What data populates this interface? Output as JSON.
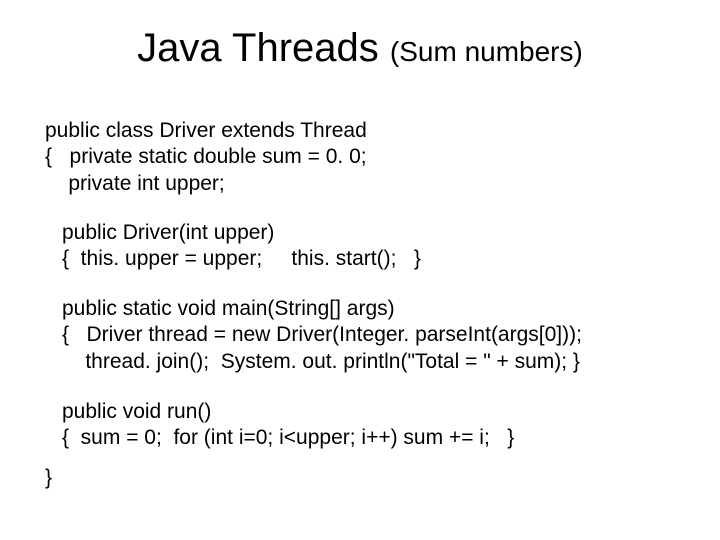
{
  "title": {
    "main": "Java Threads ",
    "sub": "(Sum numbers)"
  },
  "code": {
    "block1": "public class Driver extends Thread\n{   private static double sum = 0. 0;\n    private int upper;",
    "block2": "public Driver(int upper)\n{  this. upper = upper;     this. start();   }",
    "block3": "public static void main(String[] args)\n{   Driver thread = new Driver(Integer. parseInt(args[0]));\n    thread. join();  System. out. println(\"Total = \" + sum); }",
    "block4": "public void run()\n{  sum = 0;  for (int i=0; i<upper; i++) sum += i;   }",
    "block5": "}"
  }
}
